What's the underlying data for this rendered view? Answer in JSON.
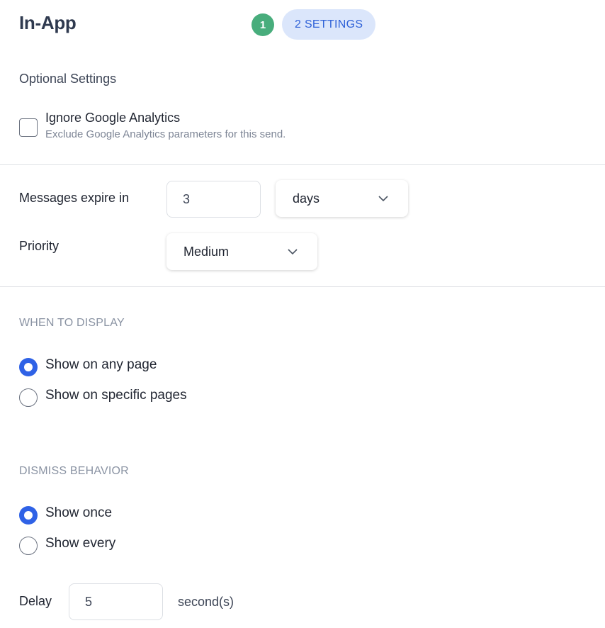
{
  "header": {
    "title": "In-App",
    "step_number": "1",
    "current_step_label": "2 SETTINGS"
  },
  "optional_settings": {
    "title": "Optional Settings",
    "ignore_ga": {
      "label": "Ignore Google Analytics",
      "description": "Exclude Google Analytics parameters for this send.",
      "checked": false
    }
  },
  "expiry": {
    "label": "Messages expire in",
    "value": "3",
    "unit": "days"
  },
  "priority": {
    "label": "Priority",
    "value": "Medium"
  },
  "when_to_display": {
    "heading": "WHEN TO DISPLAY",
    "options": [
      {
        "label": "Show on any page",
        "selected": true
      },
      {
        "label": "Show on specific pages",
        "selected": false
      }
    ]
  },
  "dismiss_behavior": {
    "heading": "DISMISS BEHAVIOR",
    "options": [
      {
        "label": "Show once",
        "selected": true
      },
      {
        "label": "Show every",
        "selected": false
      }
    ]
  },
  "delay": {
    "label": "Delay",
    "value": "5",
    "unit": "second(s)"
  },
  "colors": {
    "accent": "#2f62e6",
    "step_done": "#48ad7c",
    "step_pill_bg": "#dbe6fb"
  },
  "icons": {
    "chevron": "chevron-down-icon"
  }
}
